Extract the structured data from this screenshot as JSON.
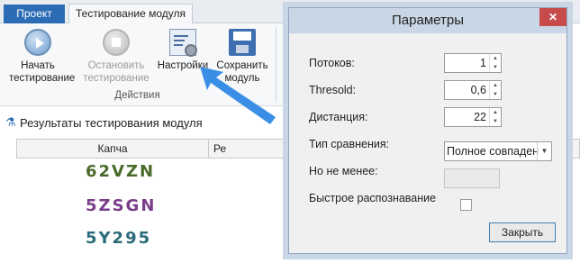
{
  "tabs": {
    "project": "Проект",
    "testing": "Тестирование модуля"
  },
  "ribbon": {
    "start": "Начать тестирование",
    "stop": "Остановить тестирование",
    "settings": "Настройки",
    "save": "Сохранить модуль",
    "group": "Действия"
  },
  "results": {
    "title": "Результаты тестирования модуля",
    "col_captcha": "Капча",
    "col_result": "Ре",
    "captchas": [
      "62VZN",
      "5ZSGN",
      "5Y295"
    ]
  },
  "dialog": {
    "title": "Параметры",
    "close_x": "✕",
    "threads_label": "Потоков:",
    "threads_value": "1",
    "threshold_label": "Thresold:",
    "threshold_value": "0,6",
    "distance_label": "Дистанция:",
    "distance_value": "22",
    "compare_label": "Тип сравнения:",
    "compare_value": "Полное совпадение",
    "min_label": "Но не менее:",
    "fast_label": "Быстрое распознавание",
    "close_button": "Закрыть"
  },
  "colors": {
    "accent": "#2b6cb5",
    "arrow": "#3a8ee6",
    "close": "#c74b4b"
  }
}
